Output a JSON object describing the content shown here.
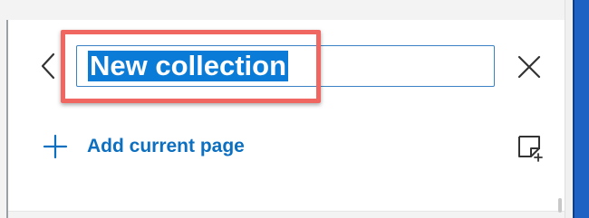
{
  "collection_panel": {
    "name_input": {
      "value": "New collection"
    },
    "add_page": {
      "label": "Add current page"
    }
  },
  "icons": {
    "back": "chevron-left-icon",
    "close": "close-icon",
    "add": "plus-icon",
    "note": "add-note-icon"
  },
  "colors": {
    "accent": "#0c6fc0",
    "selection": "#0a7bd6",
    "input_border": "#3b82c4",
    "callout": "#f06660"
  }
}
